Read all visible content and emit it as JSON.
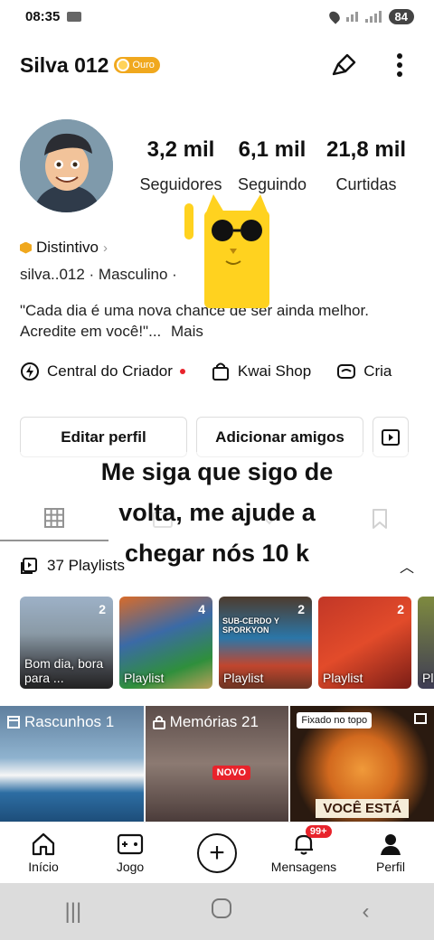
{
  "status_bar": {
    "time": "08:35",
    "battery": "84"
  },
  "header": {
    "username": "Silva 012",
    "badge": "Ouro"
  },
  "stats": [
    {
      "value": "3,2 mil",
      "label": "Seguidores"
    },
    {
      "value": "6,1 mil",
      "label": "Seguindo"
    },
    {
      "value": "21,8 mil",
      "label": "Curtidas"
    }
  ],
  "profile": {
    "distintivo": "Distintivo",
    "info": "silva..012 · Masculino ·",
    "bio": "\"Cada dia é uma nova chance de ser ainda melhor. Acredite em você!\"...",
    "bio_more": "Mais"
  },
  "tools": [
    {
      "label": "Central do Criador"
    },
    {
      "label": "Kwai Shop"
    },
    {
      "label": "Cria"
    }
  ],
  "buttons": {
    "edit": "Editar perfil",
    "add_friends": "Adicionar amigos"
  },
  "overlay_text": {
    "line1": "Me siga que sigo de",
    "line2": "volta, me ajude a",
    "line3": "chegar  nós 10 k"
  },
  "playlists": {
    "header": "37 Playlists",
    "items": [
      {
        "count": "2",
        "caption": "Bom dia, bora para ...",
        "title": ""
      },
      {
        "count": "4",
        "caption": "Playlist",
        "title": ""
      },
      {
        "count": "2",
        "caption": "Playlist",
        "title": "SUB-CERDO Y SPORKYON"
      },
      {
        "count": "2",
        "caption": "Playlist",
        "title": ""
      },
      {
        "count": "",
        "caption": "Pl",
        "title": ""
      }
    ]
  },
  "grid": {
    "drafts": "Rascunhos 1",
    "memories": "Memórias 21",
    "new_badge": "NOVO",
    "pinned": "Fixado no topo",
    "pinned_caption": "VOCÊ ESTÁ"
  },
  "nav": {
    "home": "Início",
    "game": "Jogo",
    "messages": "Mensagens",
    "messages_badge": "99+",
    "profile": "Perfil"
  }
}
